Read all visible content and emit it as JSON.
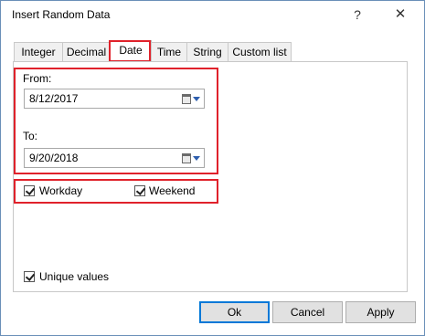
{
  "window": {
    "title": "Insert Random Data",
    "help_icon": "?",
    "close_icon": "✕"
  },
  "tabs": [
    {
      "label": "Integer",
      "active": false
    },
    {
      "label": "Decimal",
      "active": false
    },
    {
      "label": "Date",
      "active": true
    },
    {
      "label": "Time",
      "active": false
    },
    {
      "label": "String",
      "active": false
    },
    {
      "label": "Custom list",
      "active": false
    }
  ],
  "date": {
    "from_label": "From:",
    "from_value": "8/12/2017",
    "to_label": "To:",
    "to_value": "9/20/2018"
  },
  "options": {
    "workday_label": "Workday",
    "workday_checked": true,
    "weekend_label": "Weekend",
    "weekend_checked": true,
    "unique_label": "Unique values",
    "unique_checked": true
  },
  "buttons": {
    "ok": "Ok",
    "cancel": "Cancel",
    "apply": "Apply"
  },
  "colors": {
    "highlight": "#e0222b",
    "accent": "#0078d7"
  }
}
